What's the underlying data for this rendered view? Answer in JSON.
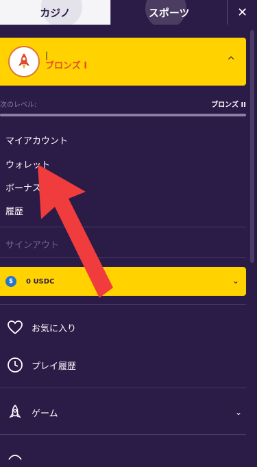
{
  "tabs": {
    "casino": "カジノ",
    "sports": "スポーツ"
  },
  "close_label": "✕",
  "level": {
    "user": "|",
    "rank": "ブロンズ I",
    "chevron": "^"
  },
  "next_level": {
    "label": "次のレベル:",
    "value": "ブロンズ II",
    "progress": 1.0
  },
  "menu": {
    "items": [
      "マイアカウント",
      "ウォレット",
      "ボーナス",
      "履歴"
    ],
    "signout": "サインアウト"
  },
  "wallet": {
    "amount": "0 USDC",
    "icon": "usdc-icon"
  },
  "nav": [
    {
      "label": "お気に入り",
      "icon": "heart-icon"
    },
    {
      "label": "プレイ履歴",
      "icon": "clock-icon"
    },
    {
      "label": "ゲーム",
      "icon": "rocket-icon"
    }
  ],
  "colors": {
    "bg": "#2b1b47",
    "accent": "#ffd200",
    "arrow": "#f03c3c"
  }
}
